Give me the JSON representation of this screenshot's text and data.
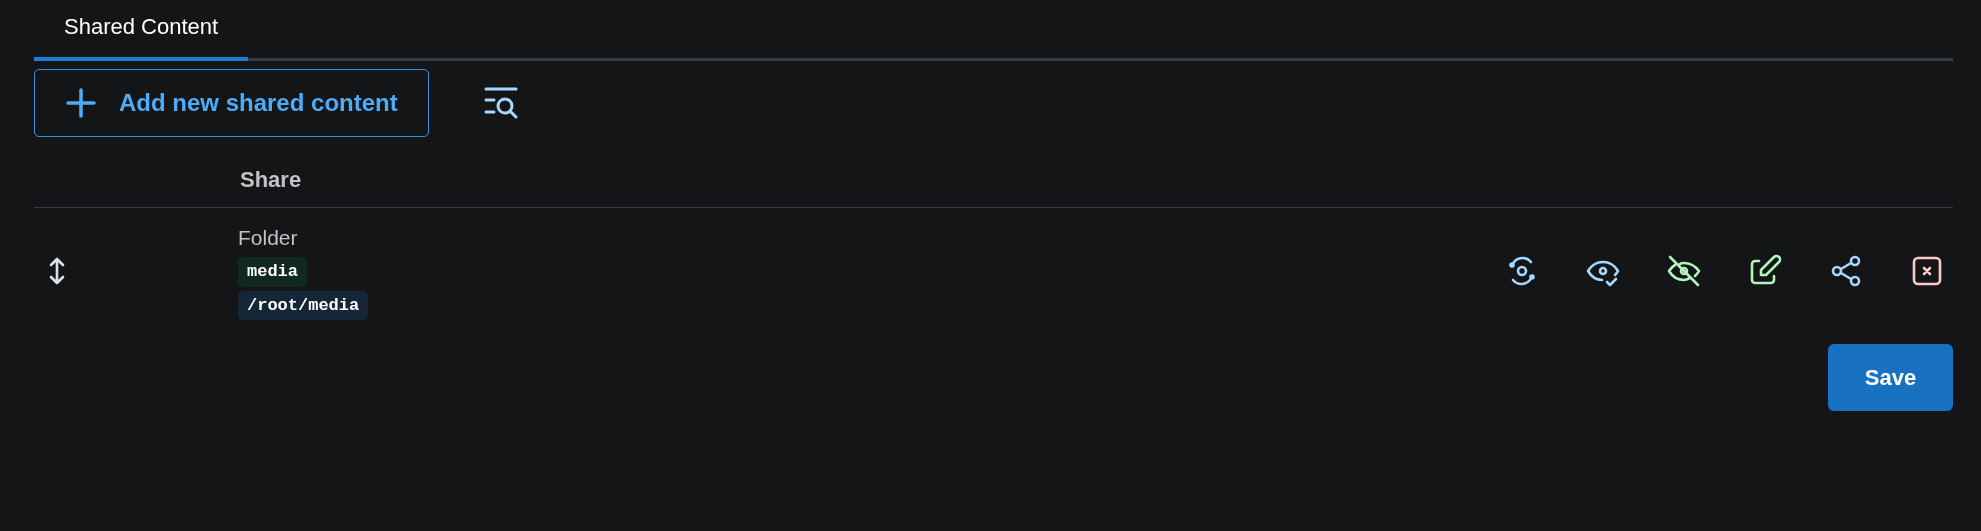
{
  "tabs": [
    {
      "label": "Shared Content",
      "selected": true
    }
  ],
  "add_button": {
    "label": "Add new shared content"
  },
  "table": {
    "columns": [
      "Share"
    ],
    "rows": [
      {
        "type": "Folder",
        "name": "media",
        "path": "/root/media",
        "actions": [
          {
            "kind": "sync",
            "color": "#a5d8ff"
          },
          {
            "kind": "view",
            "color": "#a5d8ff"
          },
          {
            "kind": "hide",
            "color": "#b2f2bb"
          },
          {
            "kind": "edit",
            "color": "#b2f2bb"
          },
          {
            "kind": "share",
            "color": "#a5d8ff"
          },
          {
            "kind": "delete",
            "color": "#ffc9c9"
          }
        ]
      }
    ]
  },
  "save_button": {
    "label": "Save"
  }
}
